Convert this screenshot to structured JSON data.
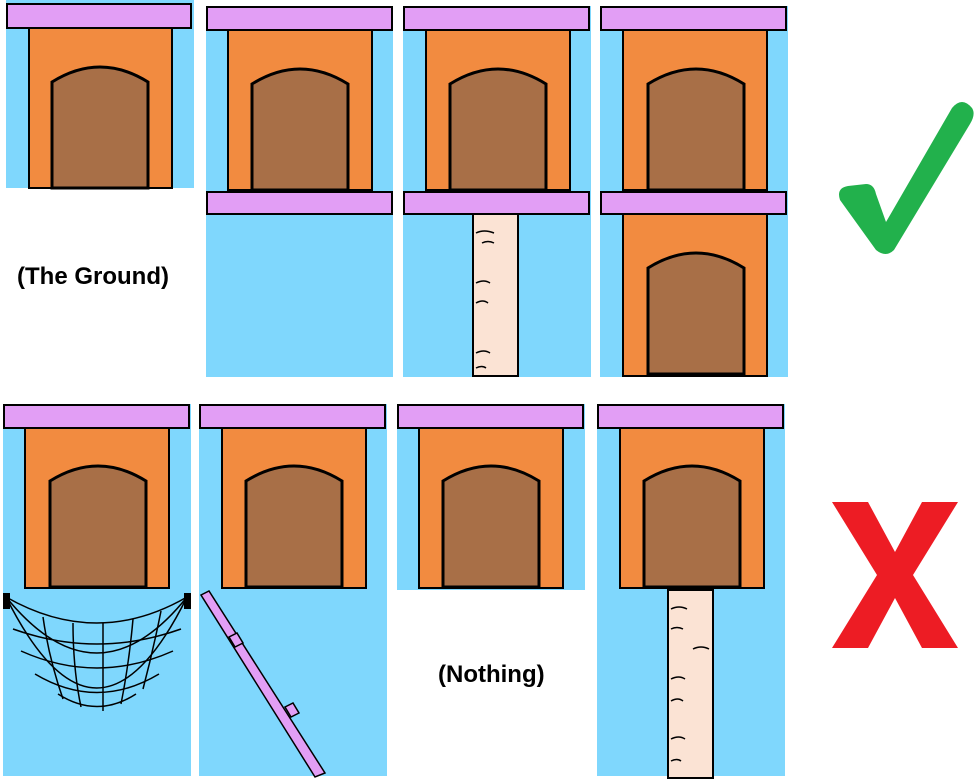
{
  "labels": {
    "ground": "(The Ground)",
    "nothing": "(Nothing)"
  },
  "marks": {
    "correct": "checkmark",
    "incorrect": "x-mark"
  },
  "colors": {
    "sky": "#7fd7fd",
    "roof": "#e29ef5",
    "house": "#f28b40",
    "door": "#a86f47",
    "trunk": "#fbe3d4",
    "check": "#22b14c",
    "cross": "#ed1c24"
  }
}
